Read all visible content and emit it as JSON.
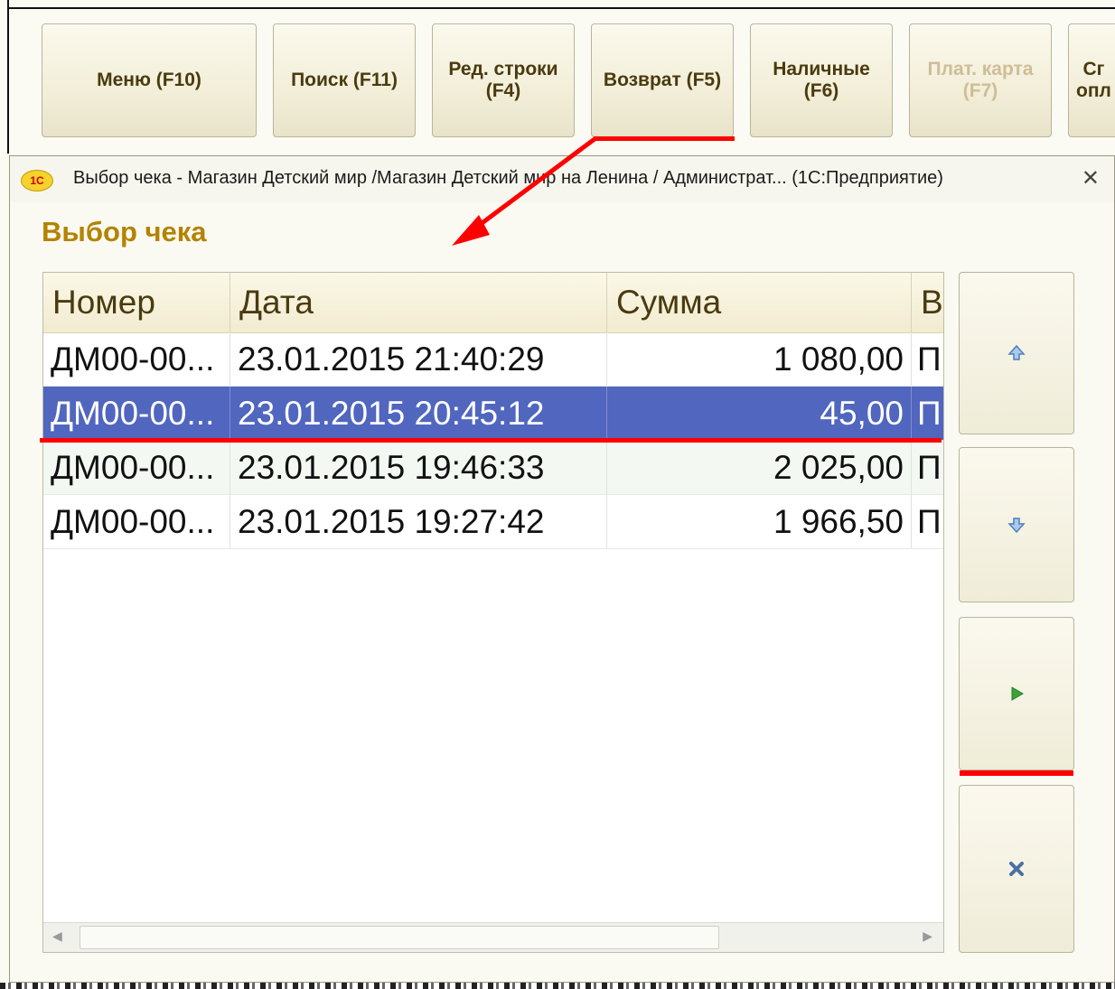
{
  "toolbar": {
    "menu_label": "Меню (F10)",
    "search_label": "Поиск (F11)",
    "edit_row_label": "Ред. строки\n(F4)",
    "return_label": "Возврат (F5)",
    "cash_label": "Наличные\n(F6)",
    "card_label": "Плат. карта\n(F7)",
    "other_label": "Сг\nопл"
  },
  "dialog": {
    "window_title": "Выбор чека - Магазин Детский мир /Магазин Детский мир на Ленина / Администрат... (1С:Предприятие)",
    "logo_text": "1С",
    "close_glyph": "✕",
    "form_title": "Выбор чека"
  },
  "table": {
    "columns": [
      "Номер",
      "Дата",
      "Сумма",
      "В"
    ],
    "rows": [
      {
        "number": "ДМ00-00...",
        "date": "23.01.2015 21:40:29",
        "sum": "1 080,00",
        "extra": "П"
      },
      {
        "number": "ДМ00-00...",
        "date": "23.01.2015 20:45:12",
        "sum": "45,00",
        "extra": "П"
      },
      {
        "number": "ДМ00-00...",
        "date": "23.01.2015 19:46:33",
        "sum": "2 025,00",
        "extra": "П"
      },
      {
        "number": "ДМ00-00...",
        "date": "23.01.2015 19:27:42",
        "sum": "1 966,50",
        "extra": "П"
      }
    ],
    "selected_row": 2
  },
  "side_buttons": {
    "up_icon": "arrow-up-icon",
    "down_icon": "arrow-down-icon",
    "select_icon": "play-icon",
    "cancel_icon": "close-icon"
  },
  "colors": {
    "selection": "#5166bf",
    "accent_title": "#b38300",
    "annotation": "#ff0000"
  }
}
